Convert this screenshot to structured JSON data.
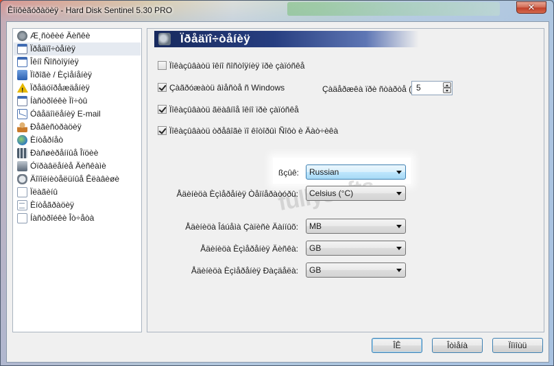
{
  "window": {
    "title": "Êîíôèãóðàöèÿ - Hard Disk Sentinel 5.30 PRO",
    "close_glyph": "✕"
  },
  "sidebar": {
    "items": [
      {
        "label": "Æ¸ñòêèé Äèñêè",
        "icon": "gear-icon"
      },
      {
        "label": "Ïðåäïî÷òåíèÿ",
        "icon": "document-icon",
        "selected": true
      },
      {
        "label": "Îêíî Ñîñòîÿíèÿ",
        "icon": "window-icon"
      },
      {
        "label": "Ïîðîãè / Èçìåíåíèÿ",
        "icon": "chart-icon"
      },
      {
        "label": "Ïðåäóïðåæäåíèÿ",
        "icon": "warning-icon"
      },
      {
        "label": "Íàñòðîéêè Ïî÷òû",
        "icon": "document-icon"
      },
      {
        "label": "Óâåäîìëåíèÿ E-mail",
        "icon": "mail-icon"
      },
      {
        "label": "Ðåãèñòðàöèÿ",
        "icon": "person-icon"
      },
      {
        "label": "Èíòåðíåò",
        "icon": "globe-icon"
      },
      {
        "label": "Ðàñøèðåííûå Îïöèè",
        "icon": "grid-icon"
      },
      {
        "label": "Óïðàâëåíèå Äèñêàìè",
        "icon": "disk-icon"
      },
      {
        "label": "Äîïîëíèòåëüíûå Êëàâèøè",
        "icon": "mouse-icon"
      },
      {
        "label": "Ïëàãèíû",
        "icon": "page-icon"
      },
      {
        "label": "Èíòåãðàöèÿ",
        "icon": "page-icon"
      },
      {
        "label": "Íàñòðîéêè Îò÷åòà",
        "icon": "page-icon"
      }
    ]
  },
  "panel": {
    "title": "Ïðåäïî÷òåíèÿ",
    "checkboxes": [
      {
        "label": "Ïîêàçûâàòü îêíî ñîñòîÿíèÿ ïðè çàïóñêå",
        "checked": false
      },
      {
        "label": "Çàãðóæàòü âìåñòå ñ Windows",
        "checked": true
      },
      {
        "label": "Ïîêàçûâàòü ãëàâíîå îêíî ïðè çàïóñêå",
        "checked": true
      },
      {
        "label": "Ïîêàçûâàòü òðåâîãè ïî êîòîðûì Ñîôò è Äàò÷èêà",
        "checked": true
      }
    ],
    "startup_delay": {
      "label": "Çàäåðæêà ïðè ñòàðòå (ñ):",
      "value": "5"
    },
    "language": {
      "label": "ßçûê:",
      "value": "Russian"
    },
    "temp_unit": {
      "label": "Åäèíèöà Èçìåðåíèÿ Òåìïåðàòóðû:",
      "value": "Celsius (°C)"
    },
    "size_unit": {
      "label": "Åäèíèöà Îáúåìà Çàïèñè Äàííûõ:",
      "value": "MB"
    },
    "disk_unit": {
      "label": "Åäèíèöà Èçìåðåíèÿ Äèñêà:",
      "value": "GB"
    },
    "part_unit": {
      "label": "Åäèíèöà Èçìåðåíèÿ Ðàçäåëà:",
      "value": "GB"
    },
    "watermark": "fullysofts"
  },
  "buttons": {
    "ok": "ÎÊ",
    "cancel": "Îòìåíà",
    "help": "Ïîìîùü"
  }
}
